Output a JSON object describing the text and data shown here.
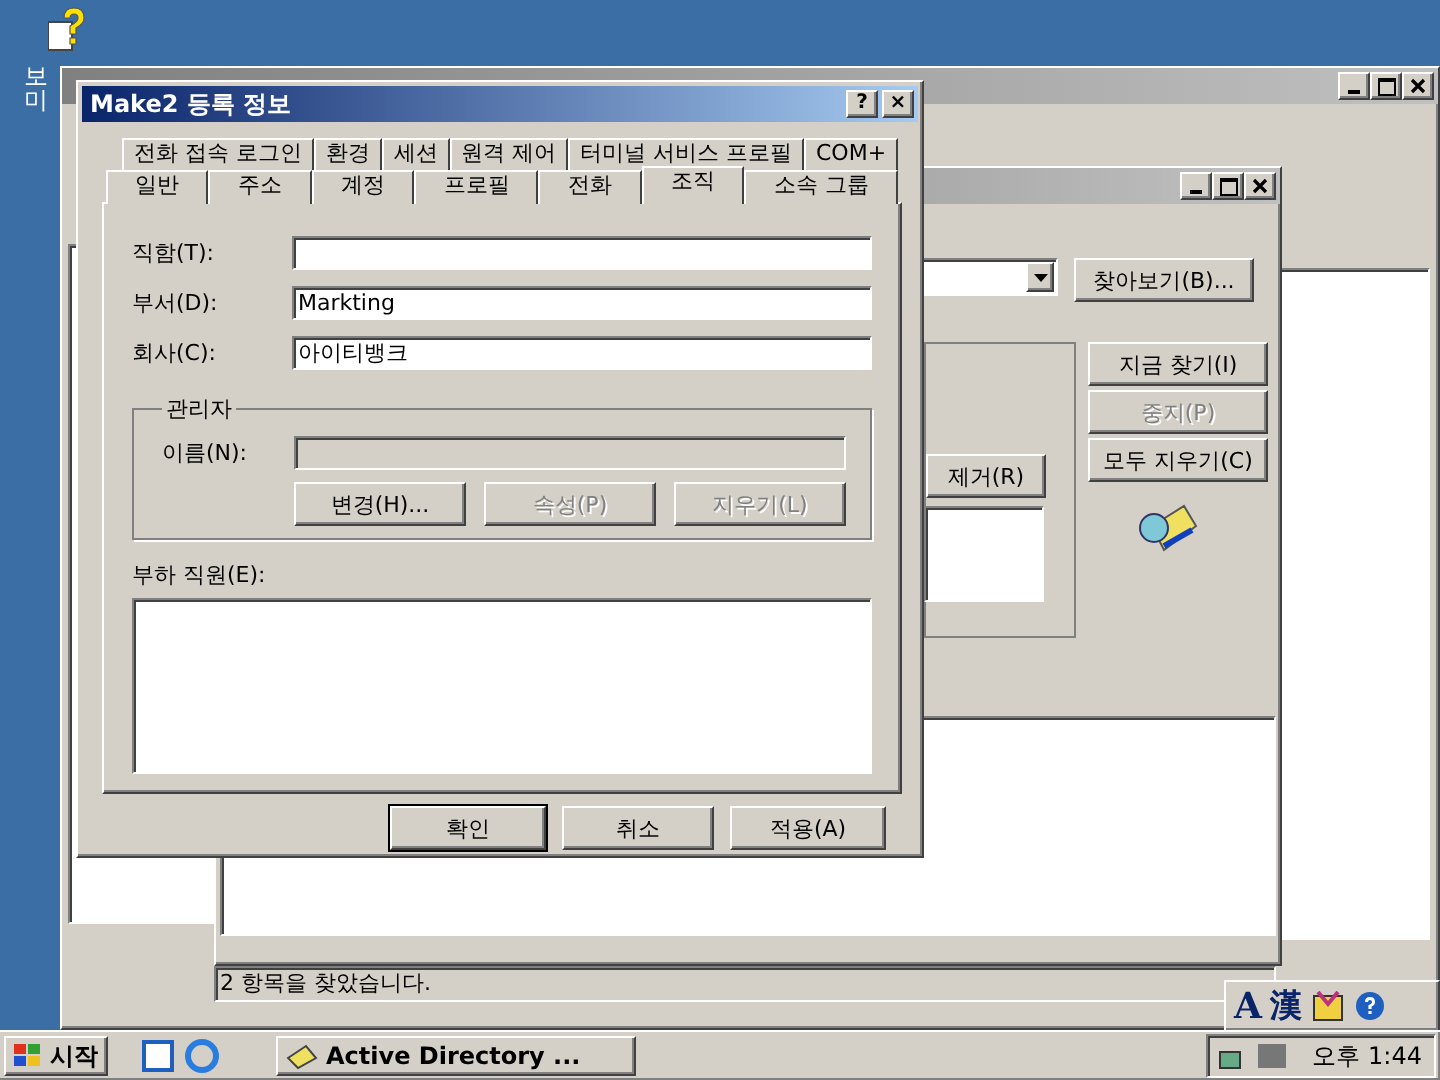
{
  "desktop_icon": {
    "label_lines": [
      "보",
      "미"
    ]
  },
  "find_window": {
    "browse_button": "찾아보기(B)...",
    "remove_button": "제거(R)",
    "actions": [
      {
        "label": "지금 찾기(I)",
        "disabled": false
      },
      {
        "label": "중지(P)",
        "disabled": true
      },
      {
        "label": "모두 지우기(C)",
        "disabled": false
      }
    ],
    "status": "2 항목을 찾았습니다."
  },
  "dialog": {
    "title": "Make2 등록 정보",
    "help_button": "?",
    "close_button": "×",
    "tab_rows": [
      [
        {
          "label": "전화 접속 로그인",
          "selected": false
        },
        {
          "label": "환경",
          "selected": false
        },
        {
          "label": "세션",
          "selected": false
        },
        {
          "label": "원격 제어",
          "selected": false
        },
        {
          "label": "터미널 서비스 프로필",
          "selected": false
        },
        {
          "label": "COM+",
          "selected": false
        }
      ],
      [
        {
          "label": "일반",
          "selected": false
        },
        {
          "label": "주소",
          "selected": false
        },
        {
          "label": "계정",
          "selected": false
        },
        {
          "label": "프로필",
          "selected": false
        },
        {
          "label": "전화",
          "selected": false
        },
        {
          "label": "조직",
          "selected": true
        },
        {
          "label": "소속 그룹",
          "selected": false
        }
      ]
    ],
    "fields": [
      {
        "label": "직함(T):"
      },
      {
        "label": "부서(D):",
        "value": "Markting"
      },
      {
        "label": "회사(C):",
        "value": "아이티뱅크"
      }
    ],
    "manager": {
      "title": "관리자",
      "name_label": "이름(N):",
      "buttons": [
        {
          "label": "변경(H)...",
          "disabled": false
        },
        {
          "label": "속성(P)",
          "disabled": true
        },
        {
          "label": "지우기(L)",
          "disabled": true
        }
      ]
    },
    "reports_label": "부하 직원(E):",
    "buttons": [
      {
        "label": "확인",
        "default": true
      },
      {
        "label": "취소",
        "default": false
      },
      {
        "label": "적용(A)",
        "default": false
      }
    ]
  },
  "language_bar": {
    "items": [
      "A",
      "漢"
    ]
  },
  "taskbar": {
    "start": "시작",
    "tasks": [
      {
        "label": "Active Directory ...",
        "selected": false
      }
    ],
    "clock": "오후 1:44"
  }
}
